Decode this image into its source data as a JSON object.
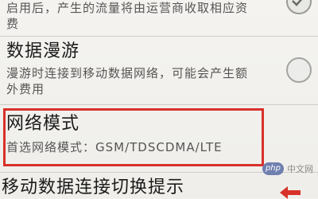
{
  "mobile_data": {
    "description_line1": "启用后，产生的流量将由运营商收取相应资",
    "description_line2": "费",
    "checked": true
  },
  "roaming": {
    "title": "数据漫游",
    "description_line1": "漫游时连接到移动数据网络，可能会产生额",
    "description_line2": "外费用",
    "checked": false
  },
  "network_mode": {
    "title": "网络模式",
    "description": "首选网络模式：GSM/TDSCDMA/LTE"
  },
  "switch_prompt": {
    "title": "移动数据连接切换提示"
  },
  "watermark": {
    "badge": "php",
    "text": "中文网"
  },
  "colors": {
    "highlight": "#d8312a",
    "background": "#f2f1ee"
  }
}
